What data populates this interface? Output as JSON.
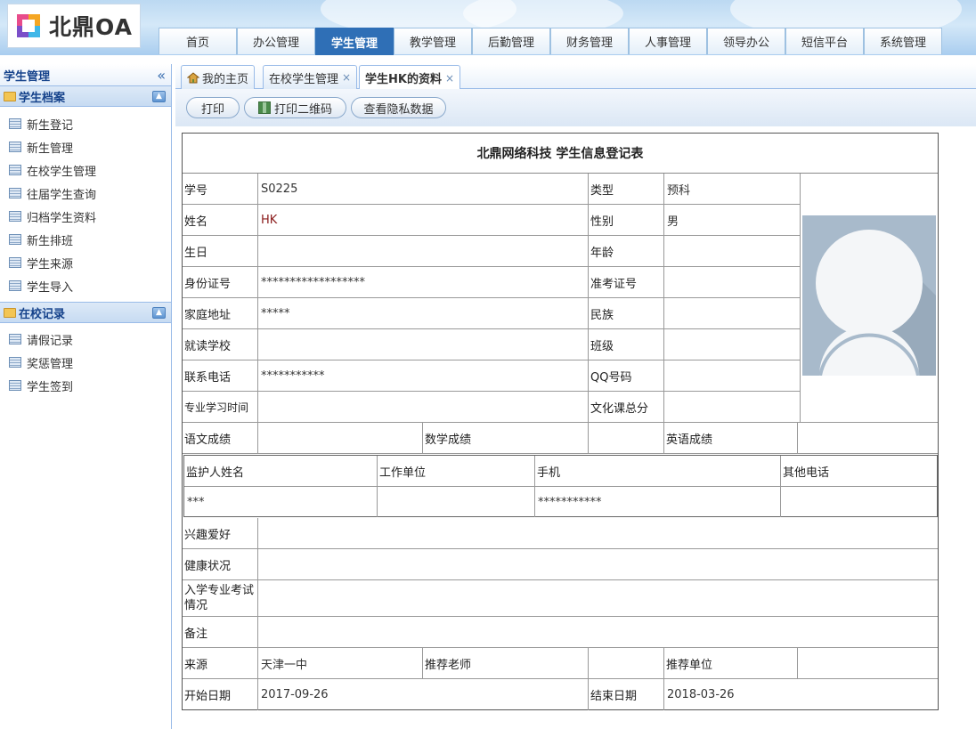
{
  "app": {
    "logo_text": "北鼎OA"
  },
  "nav": {
    "tabs": [
      {
        "label": "首页",
        "active": false
      },
      {
        "label": "办公管理",
        "active": false
      },
      {
        "label": "学生管理",
        "active": true
      },
      {
        "label": "教学管理",
        "active": false
      },
      {
        "label": "后勤管理",
        "active": false
      },
      {
        "label": "财务管理",
        "active": false
      },
      {
        "label": "人事管理",
        "active": false
      },
      {
        "label": "领导办公",
        "active": false
      },
      {
        "label": "短信平台",
        "active": false
      },
      {
        "label": "系统管理",
        "active": false
      }
    ]
  },
  "sidebar": {
    "title": "学生管理",
    "collapse_glyph": "«",
    "groups": [
      {
        "label": "学生档案",
        "items": [
          "新生登记",
          "新生管理",
          "在校学生管理",
          "往届学生查询",
          "归档学生资料",
          "新生排班",
          "学生来源",
          "学生导入"
        ]
      },
      {
        "label": "在校记录",
        "items": [
          "请假记录",
          "奖惩管理",
          "学生签到"
        ]
      }
    ]
  },
  "page_tabs": [
    {
      "label": "我的主页",
      "closable": false,
      "active": false
    },
    {
      "label": "在校学生管理",
      "closable": true,
      "active": false
    },
    {
      "label": "学生HK的资料",
      "closable": true,
      "active": true
    }
  ],
  "close_glyph": "×",
  "toolbar": {
    "print": "打印",
    "print_qr": "打印二维码",
    "view_private": "查看隐私数据"
  },
  "form": {
    "title": "北鼎网络科技 学生信息登记表",
    "student_id_label": "学号",
    "student_id": "S0225",
    "type_label": "类型",
    "type": "预科",
    "name_label": "姓名",
    "name": "HK",
    "gender_label": "性别",
    "gender": "男",
    "birthday_label": "生日",
    "birthday": "",
    "age_label": "年龄",
    "age": "",
    "id_card_label": "身份证号",
    "id_card": "******************",
    "exam_no_label": "准考证号",
    "exam_no": "",
    "address_label": "家庭地址",
    "address": "*****",
    "ethnicity_label": "民族",
    "ethnicity": "",
    "school_label": "就读学校",
    "school": "",
    "class_label": "班级",
    "class": "",
    "phone_label": "联系电话",
    "phone": "***********",
    "qq_label": "QQ号码",
    "qq": "",
    "study_time_label": "专业学习时间",
    "study_time": "",
    "culture_total_label": "文化课总分",
    "culture_total": "",
    "chinese_label": "语文成绩",
    "chinese": "",
    "math_label": "数学成绩",
    "math": "",
    "english_label": "英语成绩",
    "english": "",
    "guardian": {
      "name_label": "监护人姓名",
      "unit_label": "工作单位",
      "mobile_label": "手机",
      "other_label": "其他电话",
      "name": "***",
      "unit": "",
      "mobile": "***********",
      "other": ""
    },
    "hobby_label": "兴趣爱好",
    "hobby": "",
    "health_label": "健康状况",
    "health": "",
    "entrance_label": "入学专业考试情况",
    "entrance": "",
    "remark_label": "备注",
    "remark": "",
    "source_label": "来源",
    "source": "天津一中",
    "teacher_label": "推荐老师",
    "teacher": "",
    "unit_label": "推荐单位",
    "unit": "",
    "start_label": "开始日期",
    "start": "2017-09-26",
    "end_label": "结束日期",
    "end": "2018-03-26"
  }
}
